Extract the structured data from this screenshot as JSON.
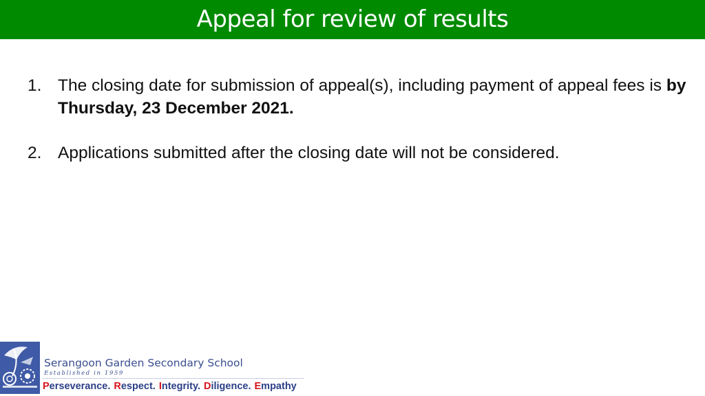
{
  "title": "Appeal for review of results",
  "items": [
    {
      "number": "1.",
      "text": "The closing date for submission of appeal(s), including payment of appeal fees is ",
      "bold": "by Thursday, 23 December 2021."
    },
    {
      "number": "2.",
      "text": "Applications submitted after the closing date will not be considered."
    }
  ],
  "footer": {
    "school_name": "Serangoon Garden Secondary School",
    "established": "Established in 1959",
    "values": [
      {
        "initial": "P",
        "rest": "erseverance."
      },
      {
        "initial": "R",
        "rest": "espect."
      },
      {
        "initial": "I",
        "rest": "ntegrity."
      },
      {
        "initial": "D",
        "rest": "iligence."
      },
      {
        "initial": "E",
        "rest": "mpathy"
      }
    ]
  },
  "colors": {
    "title_bar": "#008a00",
    "school_blue": "#3a4e8f",
    "initial_red": "#d8141c"
  }
}
